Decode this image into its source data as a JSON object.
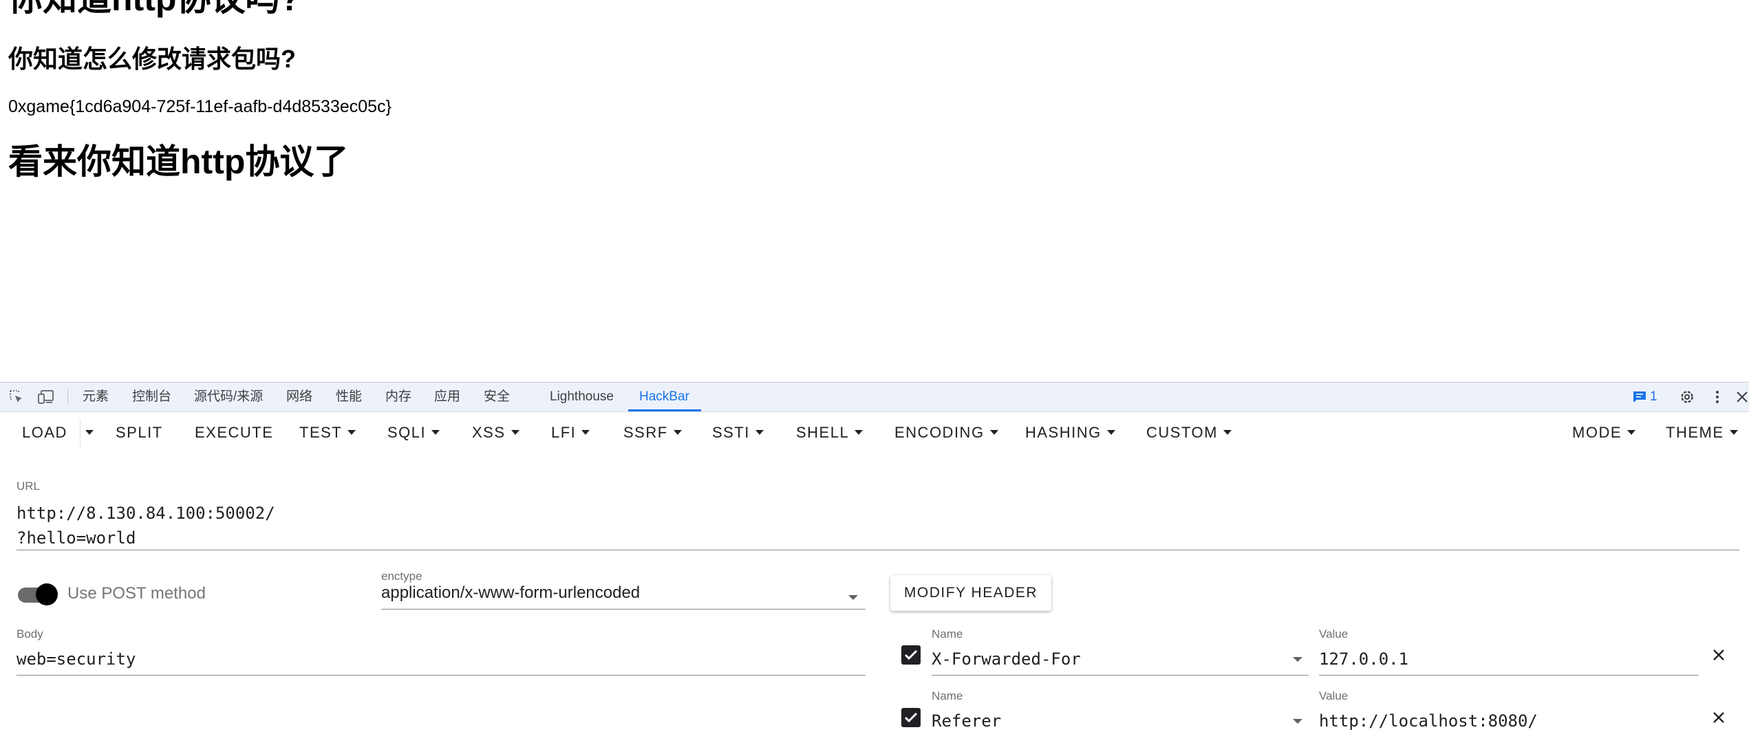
{
  "page": {
    "heading_top": "你知道http协议吗?",
    "subheading": "你知道怎么修改请求包吗?",
    "flag": "0xgame{1cd6a904-725f-11ef-aafb-d4d8533ec05c}",
    "heading_bottom": "看来你知道http协议了"
  },
  "devtools": {
    "tabs": [
      "元素",
      "控制台",
      "源代码/来源",
      "网络",
      "性能",
      "内存",
      "应用",
      "安全",
      "Lighthouse",
      "HackBar"
    ],
    "active_tab": "HackBar",
    "issues_count": "1",
    "icons": [
      "inspect-element-icon",
      "device-toolbar-icon",
      "issues-icon",
      "settings-gear-icon",
      "more-options-icon",
      "close-devtools-icon"
    ]
  },
  "hackbar": {
    "toolbar": {
      "load": "LOAD",
      "split": "SPLIT",
      "execute": "EXECUTE",
      "test": "TEST",
      "sqli": "SQLI",
      "xss": "XSS",
      "lfi": "LFI",
      "ssrf": "SSRF",
      "ssti": "SSTI",
      "shell": "SHELL",
      "encoding": "ENCODING",
      "hashing": "HASHING",
      "custom": "CUSTOM",
      "mode": "MODE",
      "theme": "THEME"
    },
    "url": {
      "label": "URL",
      "value": "http://8.130.84.100:50002/\n?hello=world"
    },
    "post": {
      "label": "Use POST method",
      "enabled": true
    },
    "enctype": {
      "label": "enctype",
      "value": "application/x-www-form-urlencoded"
    },
    "modify_header_label": "MODIFY HEADER",
    "body": {
      "label": "Body",
      "value": "web=security"
    },
    "headers": [
      {
        "name_label": "Name",
        "name": "X-Forwarded-For",
        "value_label": "Value",
        "value": "127.0.0.1",
        "enabled": true
      },
      {
        "name_label": "Name",
        "name": "Referer",
        "value_label": "Value",
        "value": "http://localhost:8080/",
        "enabled": true
      }
    ]
  }
}
